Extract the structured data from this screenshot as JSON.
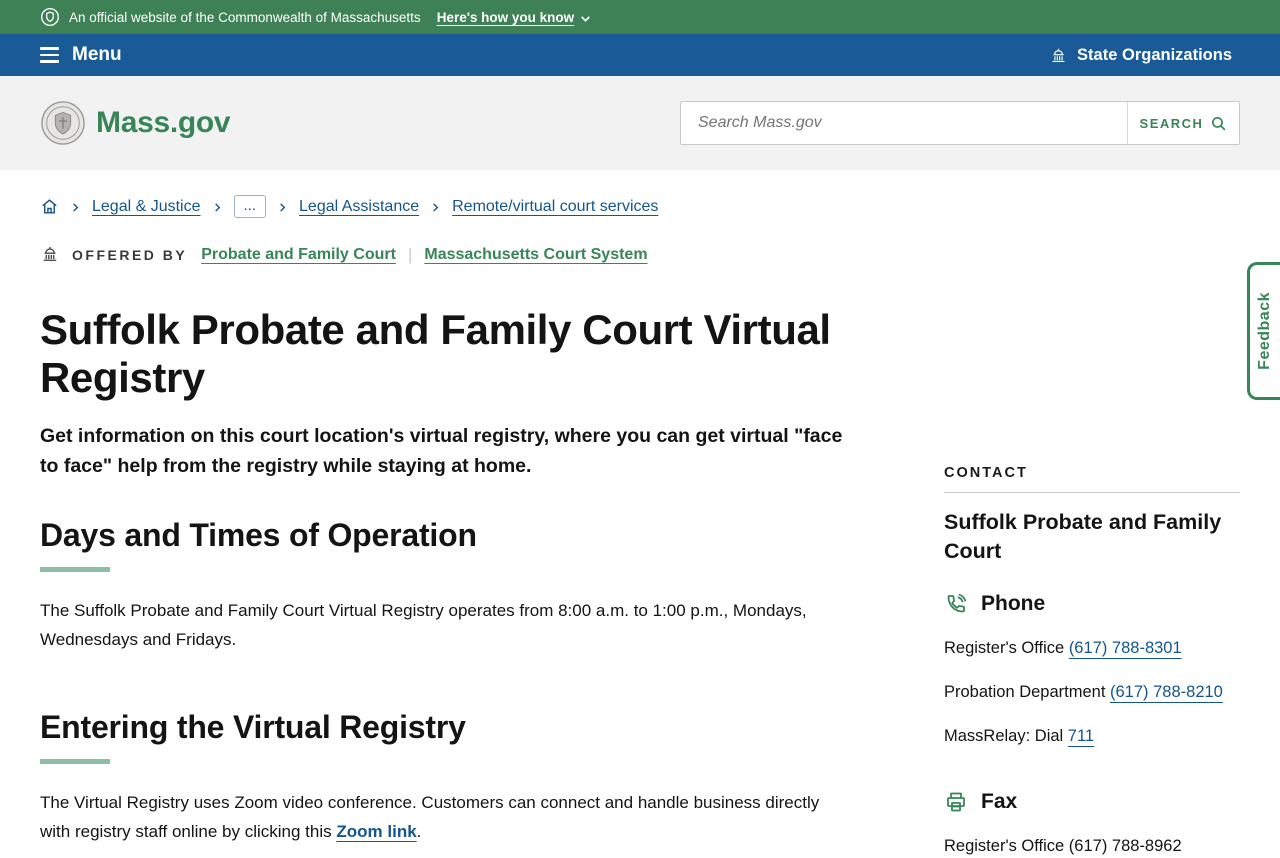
{
  "banner": {
    "official_text": "An official website of the Commonwealth of Massachusetts",
    "how_you_know_label": "Here's how you know"
  },
  "menubar": {
    "menu_label": "Menu",
    "state_organizations_label": "State Organizations"
  },
  "header": {
    "logo_text": "Mass.gov",
    "search_placeholder": "Search Mass.gov",
    "search_button_label": "SEARCH"
  },
  "breadcrumb": {
    "items": [
      "Legal & Justice",
      "...",
      "Legal Assistance",
      "Remote/virtual court services"
    ]
  },
  "offered_by": {
    "label": "OFFERED BY",
    "links": [
      "Probate and Family Court",
      "Massachusetts Court System"
    ],
    "divider": "|"
  },
  "main": {
    "title": "Suffolk Probate and Family Court Virtual Registry",
    "lead": "Get information on this court location's virtual registry, where you can get virtual \"face to face\" help from the registry while staying at home.",
    "sections": [
      {
        "heading": "Days and Times of Operation",
        "body": "The Suffolk Probate and Family Court Virtual Registry operates from 8:00 a.m. to 1:00 p.m., Mondays, Wednesdays and Fridays."
      },
      {
        "heading": "Entering the Virtual Registry",
        "body_before_link": "The Virtual Registry uses Zoom video conference. Customers can connect and handle business directly with registry staff online by clicking this ",
        "link_text": "Zoom link",
        "body_after_link": "."
      }
    ]
  },
  "sidebar": {
    "contact_label": "CONTACT",
    "org_name": "Suffolk Probate and Family Court",
    "phone": {
      "heading": "Phone",
      "rows": [
        {
          "label": "Register's Office ",
          "link": "(617) 788-8301"
        },
        {
          "label": "Probation Department ",
          "link": "(617) 788-8210"
        },
        {
          "label": "MassRelay: Dial ",
          "link": "711"
        }
      ]
    },
    "fax": {
      "heading": "Fax",
      "rows": [
        {
          "label": "Register's Office (617) 788-8962"
        }
      ]
    }
  },
  "feedback": {
    "label": "Feedback"
  },
  "colors": {
    "banner_green": "#3E8156",
    "menubar_blue": "#1A5A96",
    "brand_green": "#388557",
    "link_blue": "#14558F",
    "heading_accent": "#8FBCA4",
    "text": "#141414",
    "header_bg": "#F2F2F2"
  }
}
